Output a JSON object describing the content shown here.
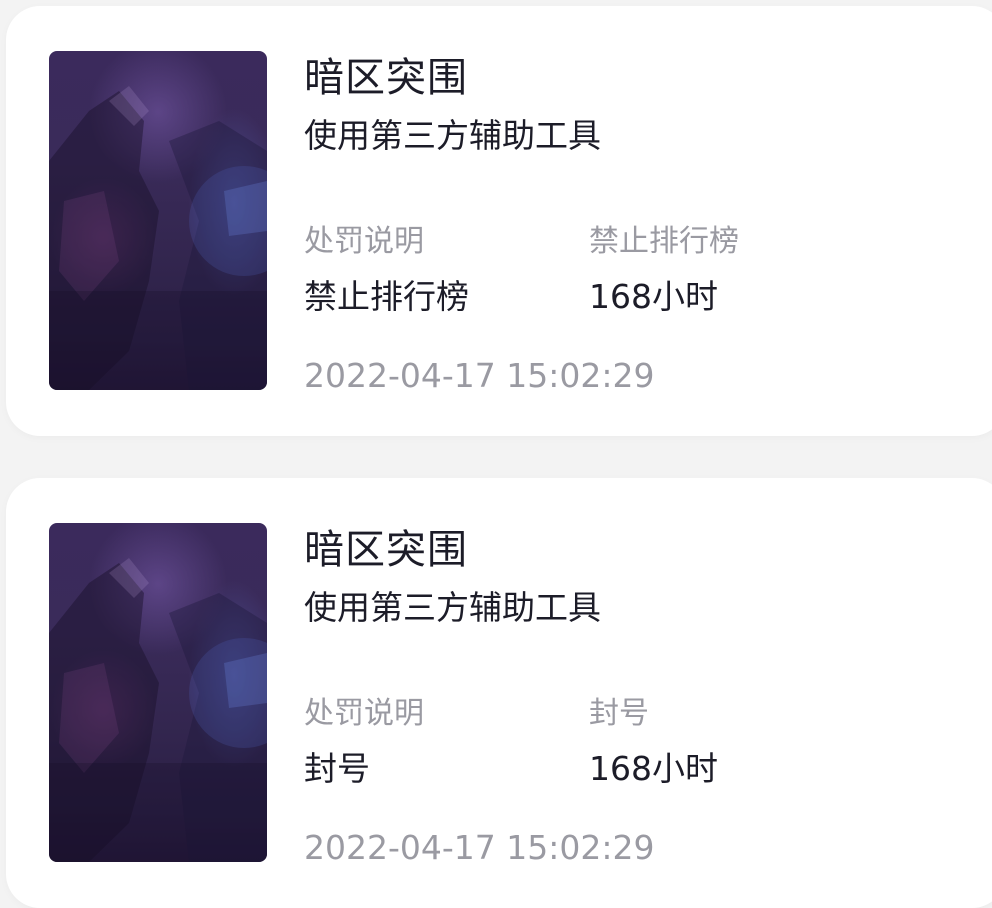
{
  "records": [
    {
      "game_title": "暗区突围",
      "reason": "使用第三方辅助工具",
      "penalty_label": "处罚说明",
      "penalty_value": "禁止排行榜",
      "type_label": "禁止排行榜",
      "duration": "168小时",
      "timestamp": "2022-04-17 15:02:29",
      "thumbnail_icon": "game-artwork"
    },
    {
      "game_title": "暗区突围",
      "reason": "使用第三方辅助工具",
      "penalty_label": "处罚说明",
      "penalty_value": "封号",
      "type_label": "封号",
      "duration": "168小时",
      "timestamp": "2022-04-17 15:02:29",
      "thumbnail_icon": "game-artwork"
    }
  ]
}
